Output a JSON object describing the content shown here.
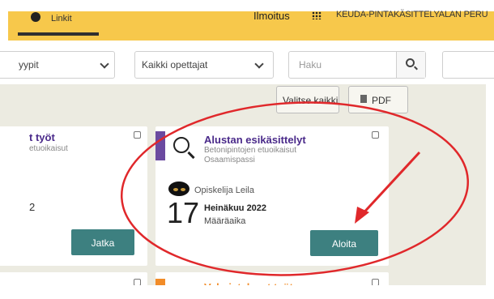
{
  "header": {
    "tab_active_label": "Linkit",
    "nav_ilmoitus": "Ilmoitus",
    "nav_org": "KEUDA-PINTAKÄSITTELYALAN PERU"
  },
  "filters": {
    "type_filter": "yypit",
    "teacher_filter": "Kaikki opettajat",
    "search_placeholder": "Haku"
  },
  "toolbar": {
    "select_all": "Valitse kaikki",
    "pdf": "PDF"
  },
  "cards": [
    {
      "title": "t työt",
      "subtitle": "etuoikaisut",
      "fragment": "2",
      "button": "Jatka"
    },
    {
      "title": "Alustan esikäsittelyt",
      "subtitle1": "Betonipintojen etuoikaisut",
      "subtitle2": "Osaamispassi",
      "student": "Opiskelija Leila",
      "day": "17",
      "month": "Heinäkuu 2022",
      "deadline_label": "Määräaika",
      "button": "Aloita"
    },
    {
      "title": "Valmistelevat työt"
    }
  ],
  "colors": {
    "topbar": "#f7c84b",
    "content_bg": "#ecebe1",
    "accent_purple": "#6b4aa0",
    "accent_orange": "#f28c28",
    "teal_button": "#3d8080",
    "annotation_red": "#e0282b"
  }
}
